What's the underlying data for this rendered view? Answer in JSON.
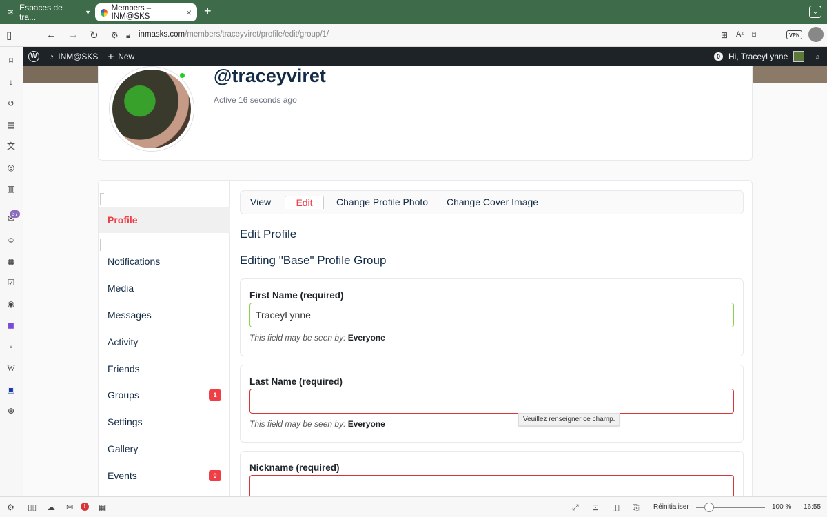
{
  "browser": {
    "workspace_label": "Espaces de tra...",
    "tab_title": "Members – INM@SKS",
    "url_domain": "inmasks.com",
    "url_path": "/members/traceyviret/profile/edit/group/1/",
    "vpn_label": "VPN",
    "sidebar_badge": "37"
  },
  "adminbar": {
    "site_name": "INM@SKS",
    "new_label": "New",
    "notification_count": "0",
    "greeting": "Hi, TraceyLynne"
  },
  "profile": {
    "username": "@traceyviret",
    "active_status": "Active 16 seconds ago"
  },
  "subnav": {
    "items": [
      {
        "label": "Profile"
      },
      {
        "label": "Notifications"
      },
      {
        "label": "Media"
      },
      {
        "label": "Messages"
      },
      {
        "label": "Activity"
      },
      {
        "label": "Friends"
      },
      {
        "label": "Groups",
        "count": "1"
      },
      {
        "label": "Settings"
      },
      {
        "label": "Gallery"
      },
      {
        "label": "Events",
        "count": "0"
      }
    ]
  },
  "tabs": [
    "View",
    "Edit",
    "Change Profile Photo",
    "Change Cover Image"
  ],
  "headings": {
    "edit_profile": "Edit Profile",
    "editing_group": "Editing \"Base\" Profile Group"
  },
  "fields": [
    {
      "label": "First Name (required)",
      "value": "TraceyLynne",
      "help_prefix": "This field may be seen by:",
      "help_value": "Everyone"
    },
    {
      "label": "Last Name (required)",
      "value": "",
      "help_prefix": "This field may be seen by:",
      "help_value": "Everyone"
    },
    {
      "label": "Nickname (required)",
      "value": ""
    }
  ],
  "tooltip": "Veuillez renseigner ce champ.",
  "statusbar": {
    "reset_label": "Réinitialiser",
    "zoom": "100 %",
    "time": "16:55",
    "mail_alert": "!"
  },
  "colors": {
    "tab_strip": "#3e6b49",
    "accent": "#ef3e46",
    "admin_bar": "#1d2327",
    "valid": "#8bd14a",
    "invalid": "#d63638"
  }
}
